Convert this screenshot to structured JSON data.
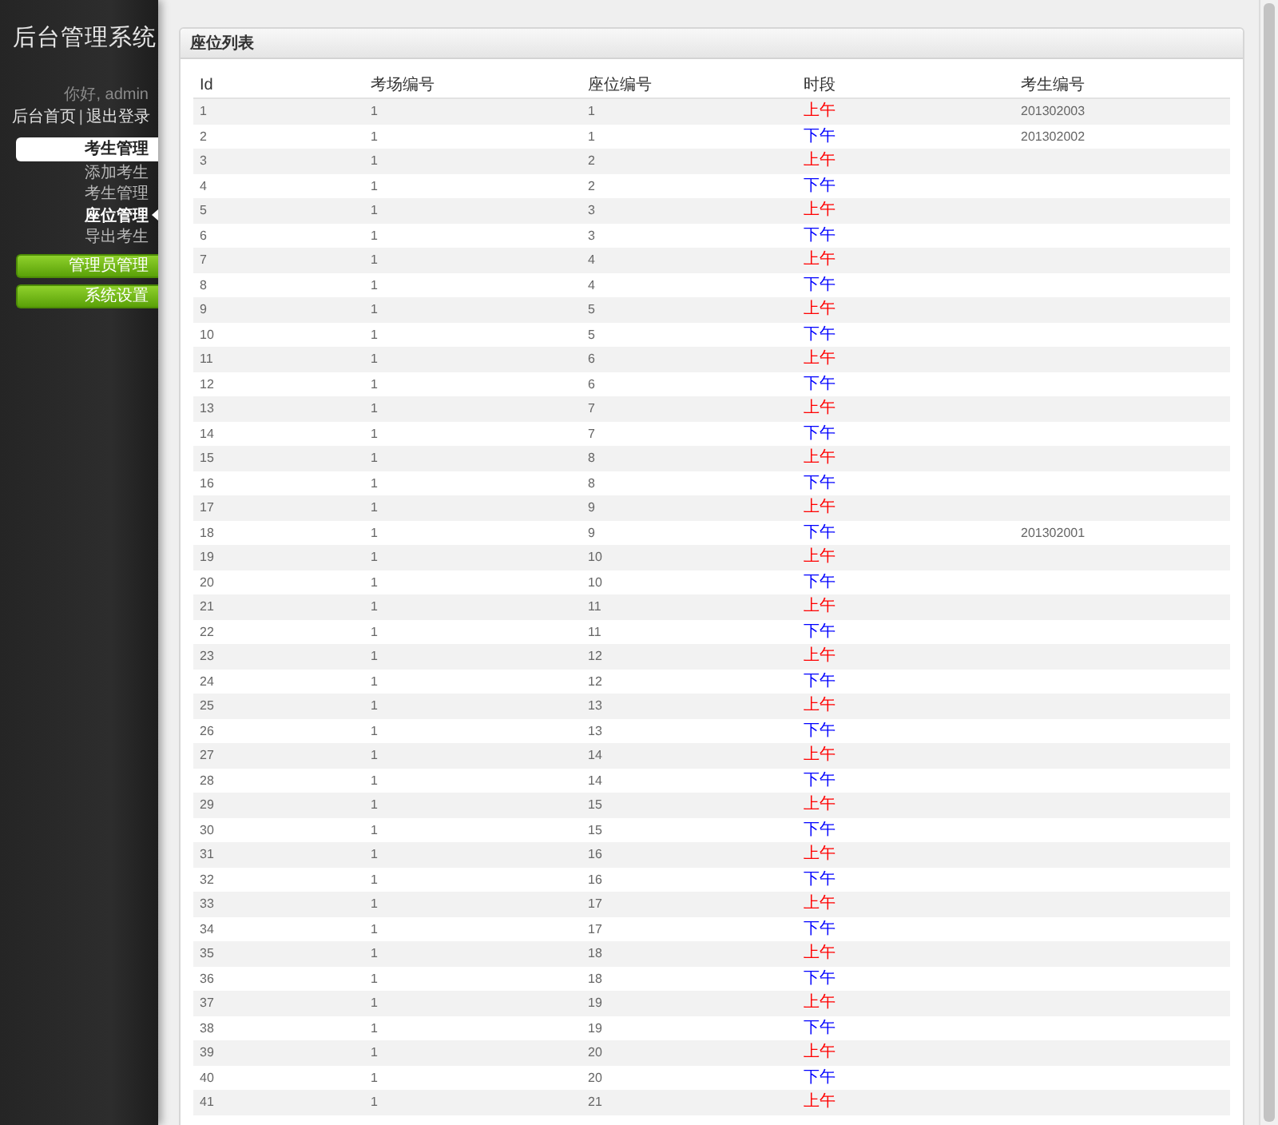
{
  "sidebar": {
    "title": "后台管理系统",
    "greeting": "你好, admin",
    "links": [
      {
        "label": "后台首页"
      },
      {
        "label": "退出登录"
      }
    ],
    "separator": "|",
    "menu": [
      {
        "label": "考生管理",
        "expanded": true,
        "children": [
          {
            "label": "添加考生",
            "selected": false
          },
          {
            "label": "考生管理",
            "selected": false
          },
          {
            "label": "座位管理",
            "selected": true
          },
          {
            "label": "导出考生",
            "selected": false
          }
        ]
      },
      {
        "label": "管理员管理",
        "expanded": false
      },
      {
        "label": "系统设置",
        "expanded": false
      }
    ]
  },
  "panel": {
    "title": "座位列表",
    "table": {
      "columns": [
        "Id",
        "考场编号",
        "座位编号",
        "时段",
        "考生编号"
      ],
      "rows": [
        {
          "id": "1",
          "room": "1",
          "seat": "1",
          "period": {
            "text": "上午",
            "color": "#ff0000"
          },
          "student_no": "201302003"
        },
        {
          "id": "2",
          "room": "1",
          "seat": "1",
          "period": {
            "text": "下午",
            "color": "#0000ff"
          },
          "student_no": "201302002"
        },
        {
          "id": "3",
          "room": "1",
          "seat": "2",
          "period": {
            "text": "上午",
            "color": "#ff0000"
          }
        },
        {
          "id": "4",
          "room": "1",
          "seat": "2",
          "period": {
            "text": "下午",
            "color": "#0000ff"
          }
        },
        {
          "id": "5",
          "room": "1",
          "seat": "3",
          "period": {
            "text": "上午",
            "color": "#ff0000"
          }
        },
        {
          "id": "6",
          "room": "1",
          "seat": "3",
          "period": {
            "text": "下午",
            "color": "#0000ff"
          }
        },
        {
          "id": "7",
          "room": "1",
          "seat": "4",
          "period": {
            "text": "上午",
            "color": "#ff0000"
          }
        },
        {
          "id": "8",
          "room": "1",
          "seat": "4",
          "period": {
            "text": "下午",
            "color": "#0000ff"
          }
        },
        {
          "id": "9",
          "room": "1",
          "seat": "5",
          "period": {
            "text": "上午",
            "color": "#ff0000"
          }
        },
        {
          "id": "10",
          "room": "1",
          "seat": "5",
          "period": {
            "text": "下午",
            "color": "#0000ff"
          }
        },
        {
          "id": "11",
          "room": "1",
          "seat": "6",
          "period": {
            "text": "上午",
            "color": "#ff0000"
          }
        },
        {
          "id": "12",
          "room": "1",
          "seat": "6",
          "period": {
            "text": "下午",
            "color": "#0000ff"
          }
        },
        {
          "id": "13",
          "room": "1",
          "seat": "7",
          "period": {
            "text": "上午",
            "color": "#ff0000"
          }
        },
        {
          "id": "14",
          "room": "1",
          "seat": "7",
          "period": {
            "text": "下午",
            "color": "#0000ff"
          }
        },
        {
          "id": "15",
          "room": "1",
          "seat": "8",
          "period": {
            "text": "上午",
            "color": "#ff0000"
          }
        },
        {
          "id": "16",
          "room": "1",
          "seat": "8",
          "period": {
            "text": "下午",
            "color": "#0000ff"
          }
        },
        {
          "id": "17",
          "room": "1",
          "seat": "9",
          "period": {
            "text": "上午",
            "color": "#ff0000"
          }
        },
        {
          "id": "18",
          "room": "1",
          "seat": "9",
          "period": {
            "text": "下午",
            "color": "#0000ff"
          },
          "student_no": "201302001"
        },
        {
          "id": "19",
          "room": "1",
          "seat": "10",
          "period": {
            "text": "上午",
            "color": "#ff0000"
          }
        },
        {
          "id": "20",
          "room": "1",
          "seat": "10",
          "period": {
            "text": "下午",
            "color": "#0000ff"
          }
        },
        {
          "id": "21",
          "room": "1",
          "seat": "11",
          "period": {
            "text": "上午",
            "color": "#ff0000"
          }
        },
        {
          "id": "22",
          "room": "1",
          "seat": "11",
          "period": {
            "text": "下午",
            "color": "#0000ff"
          }
        },
        {
          "id": "23",
          "room": "1",
          "seat": "12",
          "period": {
            "text": "上午",
            "color": "#ff0000"
          }
        },
        {
          "id": "24",
          "room": "1",
          "seat": "12",
          "period": {
            "text": "下午",
            "color": "#0000ff"
          }
        },
        {
          "id": "25",
          "room": "1",
          "seat": "13",
          "period": {
            "text": "上午",
            "color": "#ff0000"
          }
        },
        {
          "id": "26",
          "room": "1",
          "seat": "13",
          "period": {
            "text": "下午",
            "color": "#0000ff"
          }
        },
        {
          "id": "27",
          "room": "1",
          "seat": "14",
          "period": {
            "text": "上午",
            "color": "#ff0000"
          }
        },
        {
          "id": "28",
          "room": "1",
          "seat": "14",
          "period": {
            "text": "下午",
            "color": "#0000ff"
          }
        },
        {
          "id": "29",
          "room": "1",
          "seat": "15",
          "period": {
            "text": "上午",
            "color": "#ff0000"
          }
        },
        {
          "id": "30",
          "room": "1",
          "seat": "15",
          "period": {
            "text": "下午",
            "color": "#0000ff"
          }
        },
        {
          "id": "31",
          "room": "1",
          "seat": "16",
          "period": {
            "text": "上午",
            "color": "#ff0000"
          }
        },
        {
          "id": "32",
          "room": "1",
          "seat": "16",
          "period": {
            "text": "下午",
            "color": "#0000ff"
          }
        },
        {
          "id": "33",
          "room": "1",
          "seat": "17",
          "period": {
            "text": "上午",
            "color": "#ff0000"
          }
        },
        {
          "id": "34",
          "room": "1",
          "seat": "17",
          "period": {
            "text": "下午",
            "color": "#0000ff"
          }
        },
        {
          "id": "35",
          "room": "1",
          "seat": "18",
          "period": {
            "text": "上午",
            "color": "#ff0000"
          }
        },
        {
          "id": "36",
          "room": "1",
          "seat": "18",
          "period": {
            "text": "下午",
            "color": "#0000ff"
          }
        },
        {
          "id": "37",
          "room": "1",
          "seat": "19",
          "period": {
            "text": "上午",
            "color": "#ff0000"
          }
        },
        {
          "id": "38",
          "room": "1",
          "seat": "19",
          "period": {
            "text": "下午",
            "color": "#0000ff"
          }
        },
        {
          "id": "39",
          "room": "1",
          "seat": "20",
          "period": {
            "text": "上午",
            "color": "#ff0000"
          }
        },
        {
          "id": "40",
          "room": "1",
          "seat": "20",
          "period": {
            "text": "下午",
            "color": "#0000ff"
          }
        },
        {
          "id": "41",
          "room": "1",
          "seat": "21",
          "period": {
            "text": "上午",
            "color": "#ff0000"
          }
        }
      ]
    }
  }
}
